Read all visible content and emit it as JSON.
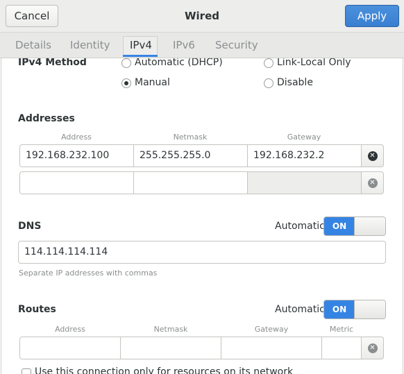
{
  "header": {
    "title": "Wired",
    "cancel_label": "Cancel",
    "apply_label": "Apply"
  },
  "tabs": [
    {
      "label": "Details"
    },
    {
      "label": "Identity"
    },
    {
      "label": "IPv4",
      "active": true
    },
    {
      "label": "IPv6"
    },
    {
      "label": "Security"
    }
  ],
  "ipv4_method": {
    "label": "IPv4 Method",
    "options": {
      "automatic": "Automatic (DHCP)",
      "link_local": "Link-Local Only",
      "manual": "Manual",
      "disable": "Disable"
    },
    "selected": "Manual"
  },
  "addresses": {
    "title": "Addresses",
    "headers": {
      "address": "Address",
      "netmask": "Netmask",
      "gateway": "Gateway"
    },
    "rows": [
      {
        "address": "192.168.232.100",
        "netmask": "255.255.255.0",
        "gateway": "192.168.232.2"
      },
      {
        "address": "",
        "netmask": "",
        "gateway": ""
      }
    ]
  },
  "dns": {
    "title": "DNS",
    "automatic_label": "Automatic",
    "switch_label": "ON",
    "value": "114.114.114.114",
    "hint": "Separate IP addresses with commas"
  },
  "routes": {
    "title": "Routes",
    "automatic_label": "Automatic",
    "switch_label": "ON",
    "headers": {
      "address": "Address",
      "netmask": "Netmask",
      "gateway": "Gateway",
      "metric": "Metric"
    },
    "rows": [
      {
        "address": "",
        "netmask": "",
        "gateway": "",
        "metric": ""
      }
    ]
  },
  "footer_checkbox": {
    "label": "Use this connection only for resources on its network"
  },
  "colors": {
    "accent": "#3584e4",
    "apply_button": "#3a80d1"
  }
}
